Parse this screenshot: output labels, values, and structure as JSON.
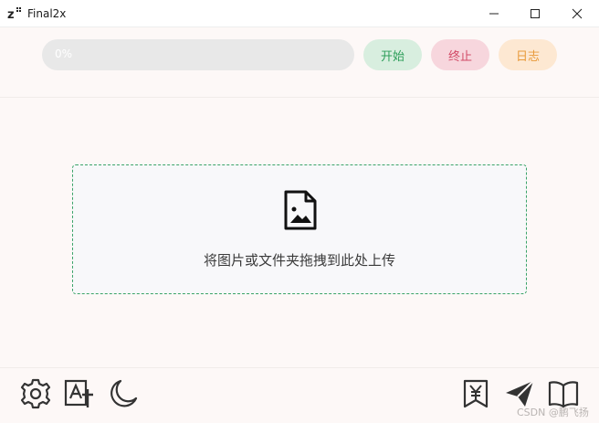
{
  "window": {
    "title": "Final2x"
  },
  "toolbar": {
    "progress_text": "0%",
    "progress_value": 0,
    "start_label": "开始",
    "stop_label": "终止",
    "log_label": "日志"
  },
  "dropzone": {
    "text": "将图片或文件夹拖拽到此处上传"
  },
  "footer": {
    "left_icons": [
      "gear-icon",
      "translate-icon",
      "moon-icon"
    ],
    "right_icons": [
      "donate-icon",
      "send-icon",
      "book-icon"
    ]
  },
  "watermark": "CSDN @鹏飞扬",
  "colors": {
    "start_bg": "#d8eedf",
    "start_fg": "#2e9e5a",
    "stop_bg": "#f7d6dd",
    "stop_fg": "#d24a66",
    "log_bg": "#fde8d2",
    "log_fg": "#e89a3a",
    "dropzone_border": "#3aa368"
  }
}
